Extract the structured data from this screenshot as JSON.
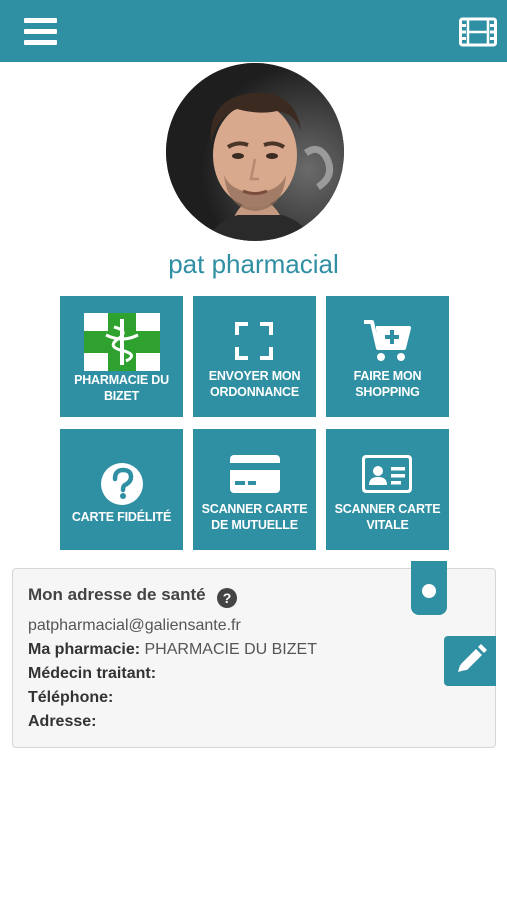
{
  "header": {
    "menu_icon": "hamburger-menu-icon",
    "media_icon": "film-strip-icon",
    "bar_color": "#2f8fa3"
  },
  "profile": {
    "name": "pat pharmacial"
  },
  "tiles": [
    {
      "label_1": "PHARMACIE DU",
      "label_2": "BIZET",
      "icon": "pharmacy-cross-logo"
    },
    {
      "label_1": "ENVOYER MON",
      "label_2": "ORDONNANCE",
      "icon": "scan-frame-icon"
    },
    {
      "label_1": "FAIRE MON",
      "label_2": "SHOPPING",
      "icon": "shopping-cart-icon"
    },
    {
      "label_1": "CARTE FIDÉLITÉ",
      "label_2": "",
      "icon": "question-circle-icon"
    },
    {
      "label_1": "SCANNER CARTE",
      "label_2": "DE MUTUELLE",
      "icon": "credit-card-icon"
    },
    {
      "label_1": "SCANNER CARTE",
      "label_2": "VITALE",
      "icon": "id-card-icon"
    }
  ],
  "health_card": {
    "title": "Mon adresse de santé",
    "email": "patpharmacial@galiensante.fr",
    "pharmacy_label": "Ma pharmacie:",
    "pharmacy_value": "PHARMACIE DU BIZET",
    "doctor_label": "Médecin traitant:",
    "doctor_value": "",
    "phone_label": "Téléphone:",
    "phone_value": "",
    "address_label": "Adresse:",
    "address_value": ""
  }
}
